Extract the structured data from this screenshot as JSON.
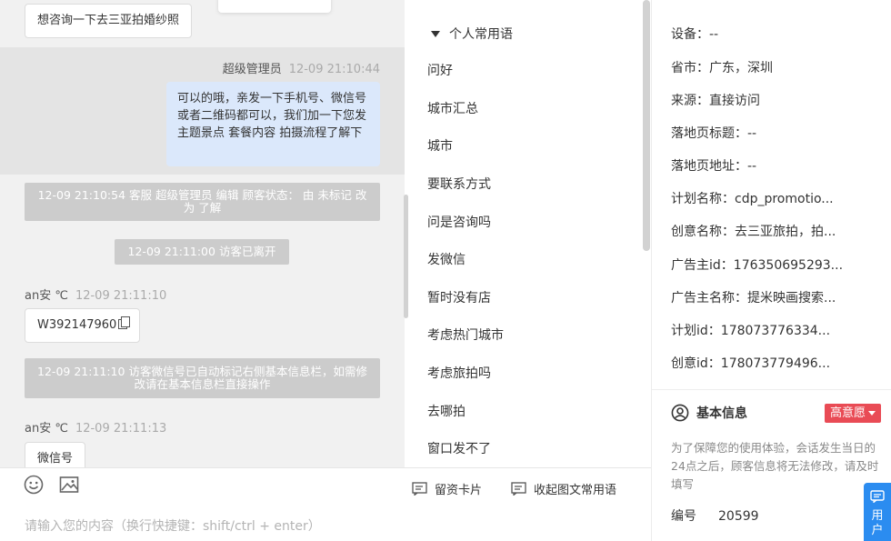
{
  "chat": {
    "messages": {
      "visitor_question": "想咨询一下去三亚拍婚纱照",
      "admin_sender": "超级管理员",
      "admin_time": "12-09 21:10:44",
      "admin_text": "可以的哦，亲发一下手机号、微信号或者二维码都可以，我们加一下您发主题景点 套餐内容 拍摄流程了解下",
      "sys_status_change": "12-09 21:10:54 客服 超级管理员 编辑 顾客状态： 由 未标记 改为 了解",
      "sys_visitor_left": "12-09 21:11:00 访客已离开",
      "visitor1_sender": "an安 ℃",
      "visitor1_time": "12-09 21:11:10",
      "visitor1_text": "W392147960",
      "sys_wechat_marked": "12-09 21:11:10 访客微信号已自动标记右侧基本信息栏，如需修改请在基本信息栏直接操作",
      "visitor2_sender": "an安 ℃",
      "visitor2_time": "12-09 21:11:13",
      "visitor2_text": "微信号"
    }
  },
  "input": {
    "placeholder": "请输入您的内容（换行快捷键：shift/ctrl + enter）",
    "lead_card_label": "留资卡片",
    "collapse_phrases_label": "收起图文常用语"
  },
  "phrases": {
    "group_title": "个人常用语",
    "items": [
      "问好",
      "城市汇总",
      "城市",
      "要联系方式",
      "问是咨询吗",
      "发微信",
      "暂时没有店",
      "考虑热门城市",
      "考虑旅拍吗",
      "去哪拍",
      "窗口发不了"
    ]
  },
  "info": {
    "rows": [
      {
        "label": "设备：",
        "value": "--"
      },
      {
        "label": "省市：",
        "value": "广东，深圳"
      },
      {
        "label": "来源：",
        "value": "直接访问"
      },
      {
        "label": "落地页标题：",
        "value": "--"
      },
      {
        "label": "落地页地址：",
        "value": "--"
      },
      {
        "label": "计划名称：",
        "value": "cdp_promotio..."
      },
      {
        "label": "创意名称：",
        "value": "去三亚旅拍，拍..."
      },
      {
        "label": "广告主id：",
        "value": "176350695293..."
      },
      {
        "label": "广告主名称：",
        "value": "提米映画搜索..."
      },
      {
        "label": "计划id：",
        "value": "178073776334..."
      },
      {
        "label": "创意id：",
        "value": "178073779496..."
      }
    ],
    "basic_title": "基本信息",
    "intent_badge": "高意愿",
    "notice": "为了保障您的使用体验，会话发生当日的24点之后，顾客信息将无法修改，请及时填写",
    "number_label": "编号",
    "number_value": "20599",
    "user_tab_label": "用户"
  },
  "colors": {
    "accent_blue": "#2b8cf0",
    "intent_red": "#e94b55",
    "admin_bubble": "#dbe8fb",
    "system_notice": "#cccccc"
  }
}
